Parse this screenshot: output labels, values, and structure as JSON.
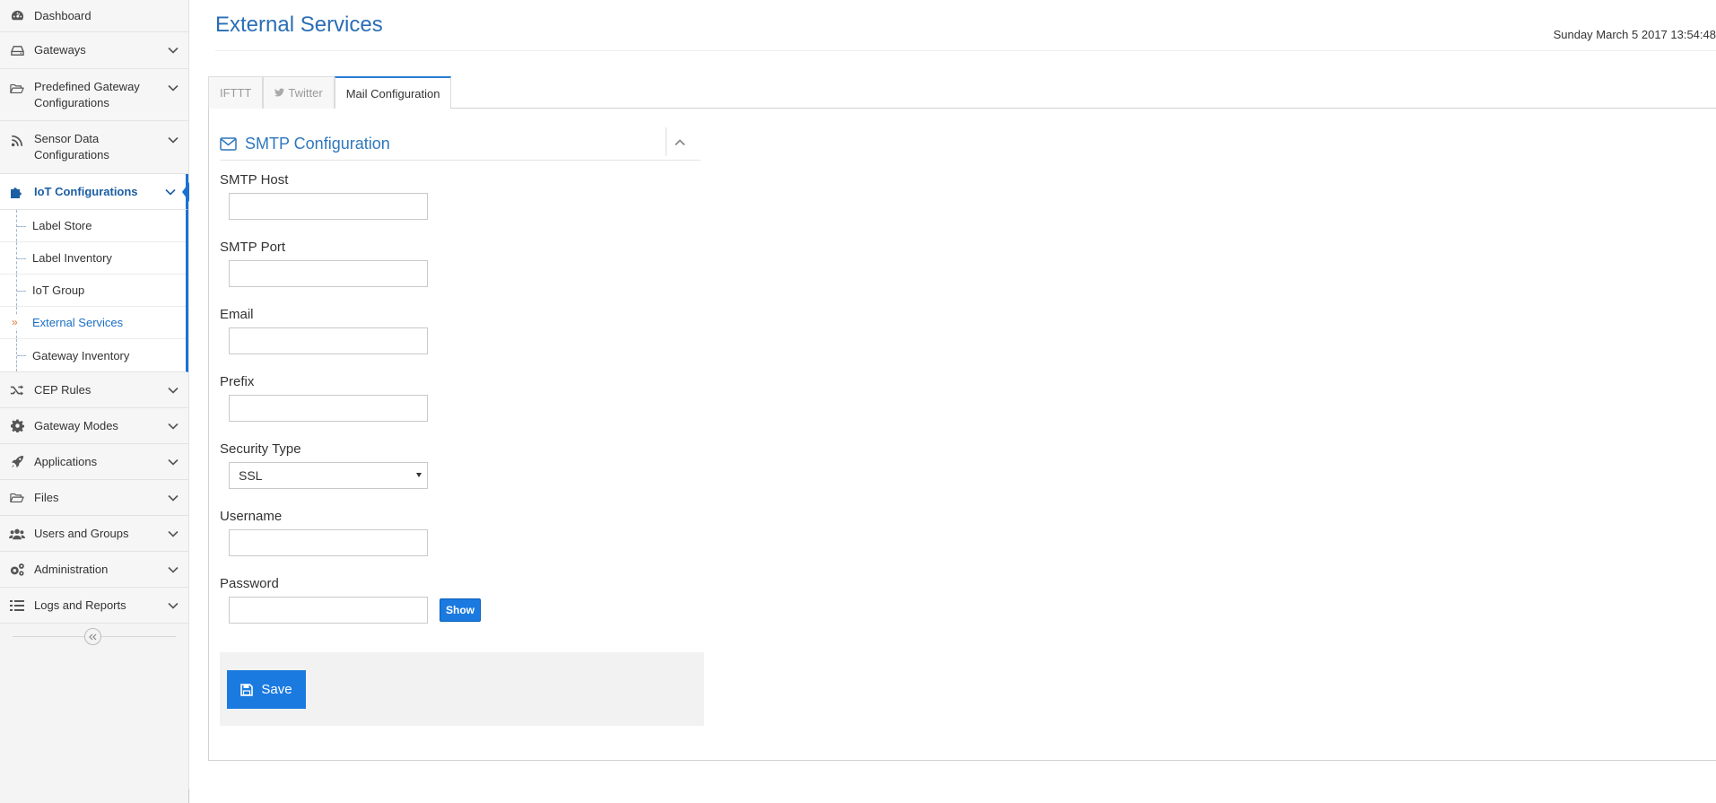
{
  "sidebar": {
    "items": [
      {
        "key": "dashboard",
        "label": "Dashboard",
        "icon": "dashboard-icon",
        "expandable": false
      },
      {
        "key": "gateways",
        "label": "Gateways",
        "icon": "hdd-icon",
        "expandable": true
      },
      {
        "key": "predefined",
        "label": "Predefined Gateway Configurations",
        "icon": "folder-open-icon",
        "expandable": true
      },
      {
        "key": "sensor",
        "label": "Sensor Data Configurations",
        "icon": "rss-icon",
        "expandable": true
      },
      {
        "key": "iot",
        "label": "IoT Configurations",
        "icon": "puzzle-icon",
        "expandable": true,
        "active": true
      },
      {
        "key": "cep",
        "label": "CEP Rules",
        "icon": "random-icon",
        "expandable": true
      },
      {
        "key": "modes",
        "label": "Gateway Modes",
        "icon": "gear-icon",
        "expandable": true
      },
      {
        "key": "apps",
        "label": "Applications",
        "icon": "rocket-icon",
        "expandable": true
      },
      {
        "key": "files",
        "label": "Files",
        "icon": "folder-open-icon",
        "expandable": true
      },
      {
        "key": "users",
        "label": "Users and Groups",
        "icon": "users-icon",
        "expandable": true
      },
      {
        "key": "admin",
        "label": "Administration",
        "icon": "gears-icon",
        "expandable": true
      },
      {
        "key": "logs",
        "label": "Logs and Reports",
        "icon": "list-icon",
        "expandable": true
      }
    ],
    "iot_submenu": [
      "Label Store",
      "Label Inventory",
      "IoT Group",
      "External Services",
      "Gateway Inventory"
    ],
    "iot_submenu_current": "External Services",
    "collapse_icon": "double-chevron-left-icon"
  },
  "header": {
    "title": "External Services",
    "datetime": "Sunday March 5 2017 13:54:48"
  },
  "tabs": [
    {
      "label": "IFTTT",
      "icon": ""
    },
    {
      "label": "Twitter",
      "icon": "twitter-icon"
    },
    {
      "label": "Mail Configuration",
      "icon": "",
      "active": true
    }
  ],
  "section": {
    "title": "SMTP Configuration",
    "icon": "envelope-icon"
  },
  "form": {
    "smtp_host": {
      "label": "SMTP Host",
      "value": ""
    },
    "smtp_port": {
      "label": "SMTP Port",
      "value": ""
    },
    "email": {
      "label": "Email",
      "value": ""
    },
    "prefix": {
      "label": "Prefix",
      "value": ""
    },
    "security_type": {
      "label": "Security Type",
      "value": "SSL"
    },
    "username": {
      "label": "Username",
      "value": ""
    },
    "password": {
      "label": "Password",
      "value": "",
      "show_label": "Show"
    }
  },
  "save": {
    "label": "Save",
    "icon": "floppy-icon"
  },
  "colors": {
    "accent": "#1a7ae0",
    "title": "#2a6eb5",
    "active_nav": "#1b5ea3",
    "sidebar_bg": "#f4f4f4",
    "current_marker": "#e07b39"
  }
}
